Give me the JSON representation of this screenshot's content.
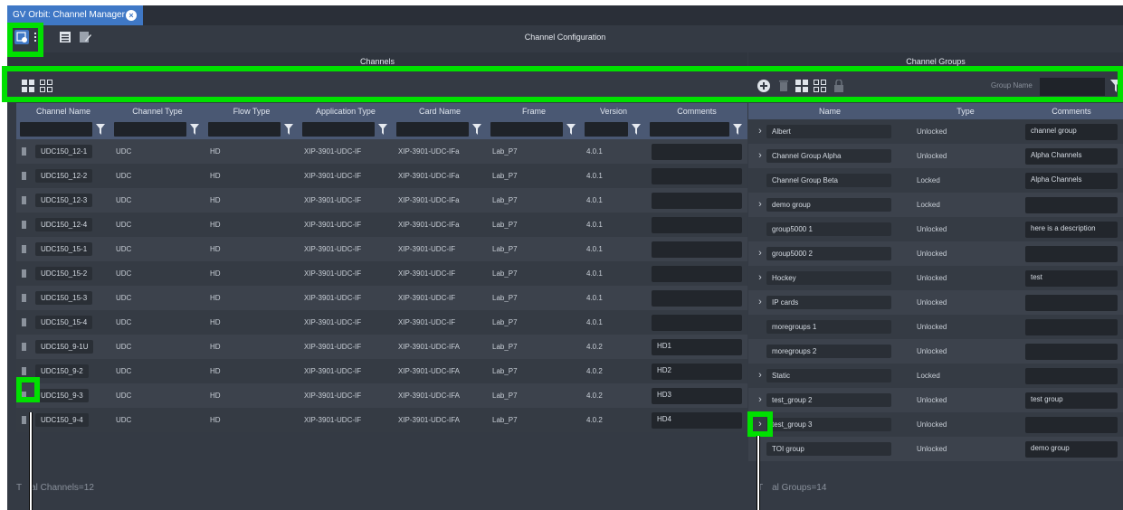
{
  "tab": {
    "title": "GV Orbit: Channel Manager"
  },
  "toolbar": {
    "title": "Channel Configuration"
  },
  "channels": {
    "panel_title": "Channels",
    "columns": [
      "Channel Name",
      "Channel Type",
      "Flow Type",
      "Application Type",
      "Card Name",
      "Frame",
      "Version",
      "Comments"
    ],
    "rows": [
      [
        "UDC150_12-1",
        "UDC",
        "HD",
        "XIP-3901-UDC-IF",
        "XIP-3901-UDC-IFa",
        "Lab_P7",
        "4.0.1",
        ""
      ],
      [
        "UDC150_12-2",
        "UDC",
        "HD",
        "XIP-3901-UDC-IF",
        "XIP-3901-UDC-IFa",
        "Lab_P7",
        "4.0.1",
        ""
      ],
      [
        "UDC150_12-3",
        "UDC",
        "HD",
        "XIP-3901-UDC-IF",
        "XIP-3901-UDC-IFa",
        "Lab_P7",
        "4.0.1",
        ""
      ],
      [
        "UDC150_12-4",
        "UDC",
        "HD",
        "XIP-3901-UDC-IF",
        "XIP-3901-UDC-IFa",
        "Lab_P7",
        "4.0.1",
        ""
      ],
      [
        "UDC150_15-1",
        "UDC",
        "HD",
        "XIP-3901-UDC-IF",
        "XIP-3901-UDC-IF",
        "Lab_P7",
        "4.0.1",
        ""
      ],
      [
        "UDC150_15-2",
        "UDC",
        "HD",
        "XIP-3901-UDC-IF",
        "XIP-3901-UDC-IF",
        "Lab_P7",
        "4.0.1",
        ""
      ],
      [
        "UDC150_15-3",
        "UDC",
        "HD",
        "XIP-3901-UDC-IF",
        "XIP-3901-UDC-IF",
        "Lab_P7",
        "4.0.1",
        ""
      ],
      [
        "UDC150_15-4",
        "UDC",
        "HD",
        "XIP-3901-UDC-IF",
        "XIP-3901-UDC-IF",
        "Lab_P7",
        "4.0.1",
        ""
      ],
      [
        "UDC150_9-1U",
        "UDC",
        "HD",
        "XIP-3901-UDC-IF",
        "XIP-3901-UDC-IFA",
        "Lab_P7",
        "4.0.2",
        "HD1"
      ],
      [
        "UDC150_9-2",
        "UDC",
        "HD",
        "XIP-3901-UDC-IF",
        "XIP-3901-UDC-IFA",
        "Lab_P7",
        "4.0.2",
        "HD2"
      ],
      [
        "UDC150_9-3",
        "UDC",
        "HD",
        "XIP-3901-UDC-IF",
        "XIP-3901-UDC-IFA",
        "Lab_P7",
        "4.0.2",
        "HD3"
      ],
      [
        "UDC150_9-4",
        "UDC",
        "HD",
        "XIP-3901-UDC-IF",
        "XIP-3901-UDC-IFA",
        "Lab_P7",
        "4.0.2",
        "HD4"
      ]
    ],
    "footer_prefix": "T",
    "footer_rest": "al Channels=12"
  },
  "groups": {
    "panel_title": "Channel Groups",
    "group_name_label": "Group Name",
    "columns": [
      "Name",
      "Type",
      "Comments"
    ],
    "rows": [
      [
        "Albert",
        "Unlocked",
        "channel group"
      ],
      [
        "Channel Group Alpha",
        "Unlocked",
        "Alpha Channels"
      ],
      [
        "Channel Group Beta",
        "Locked",
        "Alpha Channels"
      ],
      [
        "demo group",
        "Locked",
        ""
      ],
      [
        "group5000 1",
        "Unlocked",
        "here is a description"
      ],
      [
        "group5000 2",
        "Unlocked",
        ""
      ],
      [
        "Hockey",
        "Unlocked",
        "test"
      ],
      [
        "IP cards",
        "Unlocked",
        ""
      ],
      [
        "moregroups 1",
        "Unlocked",
        ""
      ],
      [
        "moregroups 2",
        "Unlocked",
        ""
      ],
      [
        "Static",
        "Locked",
        ""
      ],
      [
        "test_group 2",
        "Unlocked",
        "test group"
      ],
      [
        "test_group 3",
        "Unlocked",
        ""
      ],
      [
        "TOI group",
        "Unlocked",
        "demo group"
      ]
    ],
    "expandable": [
      true,
      true,
      false,
      true,
      false,
      true,
      true,
      true,
      false,
      false,
      true,
      true,
      true,
      false
    ],
    "footer_prefix": "T",
    "footer_rest": "al Groups=14"
  },
  "colors": {
    "highlight": "#00e000",
    "accent": "#3f78c6",
    "header": "#4a5873"
  }
}
